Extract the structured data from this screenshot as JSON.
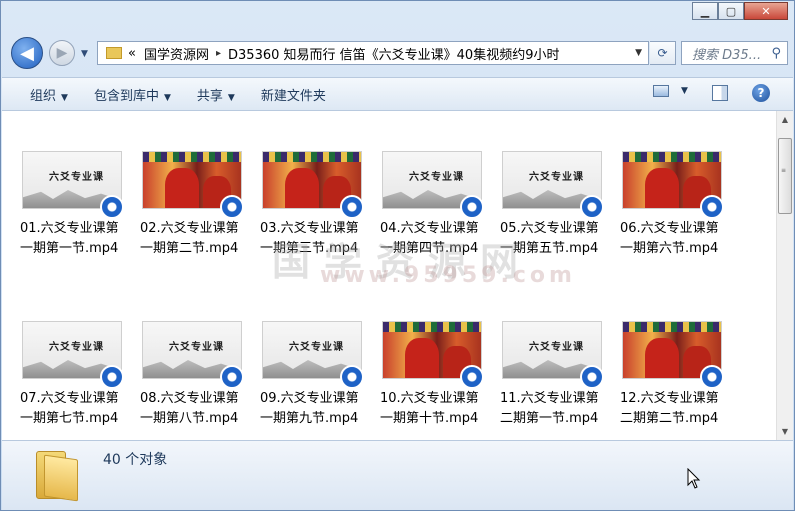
{
  "window": {
    "minimize_glyph": "▁",
    "maximize_glyph": "▢",
    "close_glyph": "✕"
  },
  "nav": {
    "back_icon": "◀",
    "forward_icon": "▶",
    "recent_dropdown_icon": "▼",
    "address": {
      "overflow": "«",
      "crumbs": [
        "国学资源网",
        "D35360 知易而行 信笛《六爻专业课》40集视频约9小时"
      ],
      "separator": "▸",
      "dropdown_icon": "▼"
    },
    "refresh_icon": "⟳",
    "search": {
      "placeholder": "搜索 D35...",
      "icon": "magnifier-icon"
    }
  },
  "toolbar": {
    "organize": "组织",
    "include_in_library": "包含到库中",
    "share": "共享",
    "new_folder": "新建文件夹",
    "dropdown_arrow": "▼",
    "help_glyph": "?"
  },
  "files": [
    {
      "name": "01.六爻专业课第一期第一节.mp4",
      "thumb": "title",
      "line1": "01.六爻专业课第",
      "line2": "一期第一节.mp4"
    },
    {
      "name": "02.六爻专业课第一期第二节.mp4",
      "thumb": "photo",
      "line1": "02.六爻专业课第",
      "line2": "一期第二节.mp4"
    },
    {
      "name": "03.六爻专业课第一期第三节.mp4",
      "thumb": "photo",
      "line1": "03.六爻专业课第",
      "line2": "一期第三节.mp4"
    },
    {
      "name": "04.六爻专业课第一期第四节.mp4",
      "thumb": "title",
      "line1": "04.六爻专业课第",
      "line2": "一期第四节.mp4"
    },
    {
      "name": "05.六爻专业课第一期第五节.mp4",
      "thumb": "title",
      "line1": "05.六爻专业课第",
      "line2": "一期第五节.mp4"
    },
    {
      "name": "06.六爻专业课第一期第六节.mp4",
      "thumb": "photo",
      "line1": "06.六爻专业课第",
      "line2": "一期第六节.mp4"
    },
    {
      "name": "07.六爻专业课第一期第七节.mp4",
      "thumb": "title",
      "line1": "07.六爻专业课第",
      "line2": "一期第七节.mp4"
    },
    {
      "name": "08.六爻专业课第一期第八节.mp4",
      "thumb": "title",
      "line1": "08.六爻专业课第",
      "line2": "一期第八节.mp4"
    },
    {
      "name": "09.六爻专业课第一期第九节.mp4",
      "thumb": "title",
      "line1": "09.六爻专业课第",
      "line2": "一期第九节.mp4"
    },
    {
      "name": "10.六爻专业课第一期第十节.mp4",
      "thumb": "photo",
      "line1": "10.六爻专业课第",
      "line2": "一期第十节.mp4"
    },
    {
      "name": "11.六爻专业课第二期第一节.mp4",
      "thumb": "title",
      "line1": "11.六爻专业课第",
      "line2": "二期第一节.mp4"
    },
    {
      "name": "12.六爻专业课第二期第二节.mp4",
      "thumb": "photo",
      "line1": "12.六爻专业课第",
      "line2": "二期第二节.mp4"
    }
  ],
  "thumbnail_title_text": "六爻专业课",
  "watermark": {
    "line1": "国学资源网",
    "line2": "www.95959.com"
  },
  "scrollbar": {
    "up": "▲",
    "down": "▼",
    "grip": "≡"
  },
  "details": {
    "count": "40 个对象"
  }
}
